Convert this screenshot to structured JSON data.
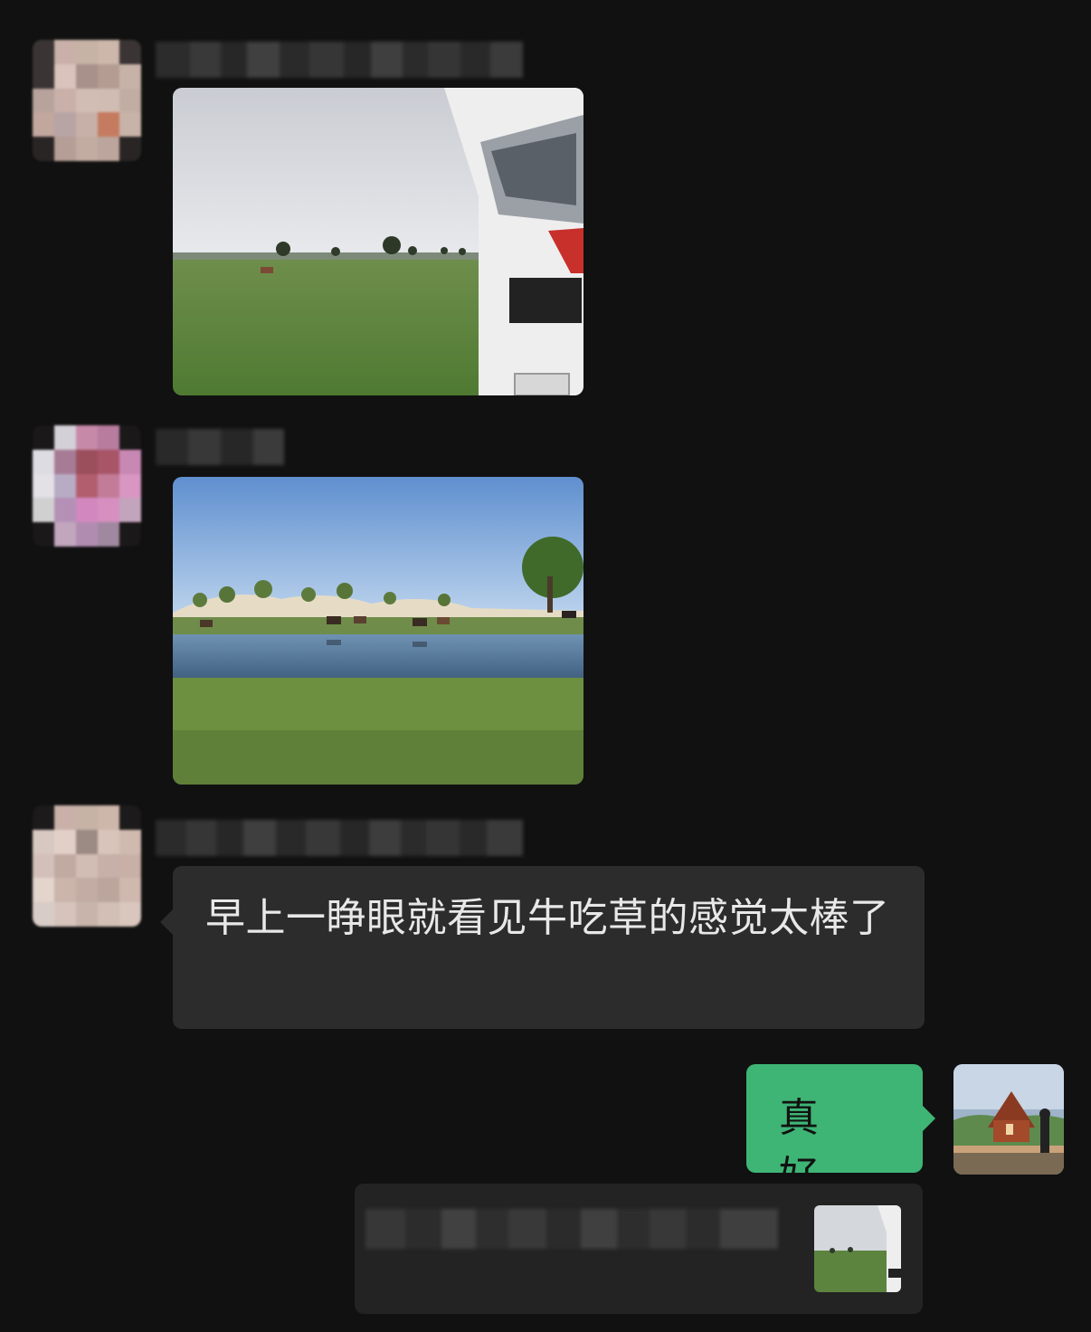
{
  "messages": [
    {
      "type": "image",
      "sender": "other",
      "alt": "grassland-with-rv"
    },
    {
      "type": "image",
      "sender": "other",
      "alt": "lake-with-horses"
    },
    {
      "type": "text",
      "sender": "other",
      "text": "早上一睁眼就看见牛吃草的感觉太棒了"
    },
    {
      "type": "text",
      "sender": "self",
      "text": "真好。"
    }
  ],
  "colors": {
    "background": "#111111",
    "other_bubble": "#2c2c2c",
    "self_bubble": "#3eb575",
    "quote_bg": "#232323"
  }
}
